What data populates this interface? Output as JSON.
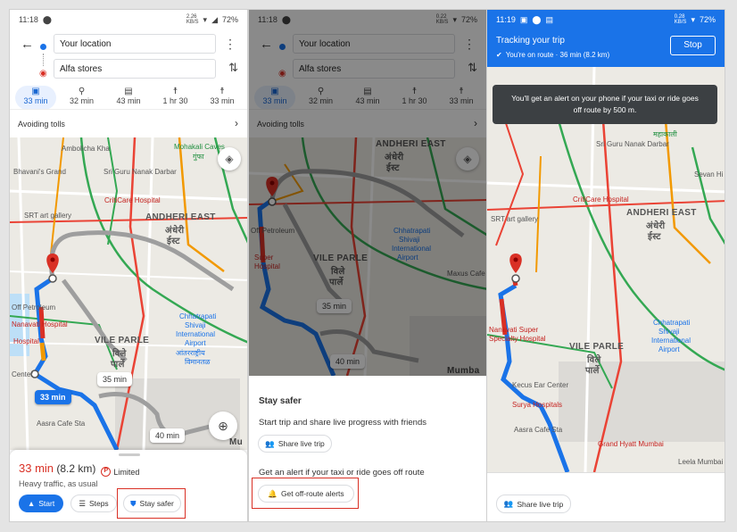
{
  "panel1": {
    "status": {
      "time": "11:18",
      "speed": "2.26\nKB/S",
      "battery": "72%"
    },
    "search": {
      "from": "Your location",
      "to": "Alfa stores"
    },
    "modes": [
      {
        "icon": "car-icon",
        "glyph": "🚗",
        "time": "33 min",
        "selected": true
      },
      {
        "icon": "motorbike-icon",
        "glyph": "🏍",
        "time": "32 min"
      },
      {
        "icon": "transit-icon",
        "glyph": "🚆",
        "time": "43 min"
      },
      {
        "icon": "walk-icon",
        "glyph": "🚶",
        "time": "1 hr 30"
      },
      {
        "icon": "ride-icon",
        "glyph": "🚶",
        "time": "33 min"
      }
    ],
    "avoiding": "Avoiding tolls",
    "map": {
      "labels": [
        "Ambolicha Kha",
        "Mohakali Caves",
        "गुंफा",
        "Bhavani's Grand",
        "Sri Guru Nanak Darbar",
        "CritiCare Hospital",
        "SRT art gallery",
        "ANDHERI EAST",
        "अंधेरी",
        "ईस्ट",
        "Off Petroleum",
        "Nanavati Hospital",
        "Hospital",
        "Center",
        "VILE PARLE",
        "विले",
        "पार्ले",
        "Chhatrapati",
        "Shivaji",
        "International",
        "Airport",
        "आंतरराष्ट्रीय",
        "विमानतळ",
        "Aasra Cafe Sta",
        "Mu"
      ],
      "bubbles": [
        "33 min",
        "35 min",
        "40 min"
      ]
    },
    "sheet": {
      "eta": "33 min",
      "dist": "(8.2 km)",
      "limited": "Limited",
      "traffic": "Heavy traffic, as usual",
      "start": "Start",
      "steps": "Steps",
      "stay_safer": "Stay safer"
    }
  },
  "panel2": {
    "status": {
      "time": "11:18",
      "speed": "0.22\nKB/S",
      "battery": "72%"
    },
    "search": {
      "from": "Your location",
      "to": "Alfa stores"
    },
    "modes": [
      "33 min",
      "32 min",
      "43 min",
      "1 hr 30",
      "33 min"
    ],
    "avoiding": "Avoiding tolls",
    "map": {
      "labels": [
        "ANDHERI EAST",
        "अंधेरी",
        "ईस्ट",
        "VILE PARLE",
        "विले",
        "पार्ले",
        "Chhatrapati",
        "Shivaji",
        "International",
        "Airport",
        "Off Petroleum",
        "Super",
        "Hospital",
        "Maxus Cafe",
        "Mumba"
      ],
      "bubbles": [
        "35 min",
        "40 min"
      ]
    },
    "sheet": {
      "title": "Stay safer",
      "line1": "Start trip and share live progress with friends",
      "share": "Share live trip",
      "line2": "Get an alert if your taxi or ride goes off route",
      "alerts": "Get off-route alerts"
    }
  },
  "panel3": {
    "status": {
      "time": "11:19",
      "speed": "0.28\nKB/S",
      "battery": "72%"
    },
    "tracking": {
      "title": "Tracking your trip",
      "sub": "You're on route · 36 min (8.2 km)",
      "stop": "Stop"
    },
    "toast": "You'll get an alert on your phone if your taxi or ride goes off route by 500 m.",
    "map": {
      "labels": [
        "Sri Guru Nanak Darbar",
        "CritiCare Hospital",
        "SRT art gallery",
        "ANDHERI EAST",
        "अंधेरी",
        "ईस्ट",
        "VILE PARLE",
        "विले",
        "पार्ले",
        "Chhatrapati",
        "Shivaji",
        "International",
        "Airport",
        "Nanavati Super",
        "Specialty Hospital",
        "Kecus Ear Center",
        "Surya Hospitals",
        "Aasra Cafe Sta",
        "Grand Hyatt Mumbai",
        "Sevan Hi",
        "Leela Mumbai",
        "महाकाली"
      ]
    },
    "share": "Share live trip"
  },
  "colors": {
    "blue": "#1a73e8",
    "red": "#d93025",
    "orange": "#f29900",
    "green": "#1e8e3e"
  }
}
